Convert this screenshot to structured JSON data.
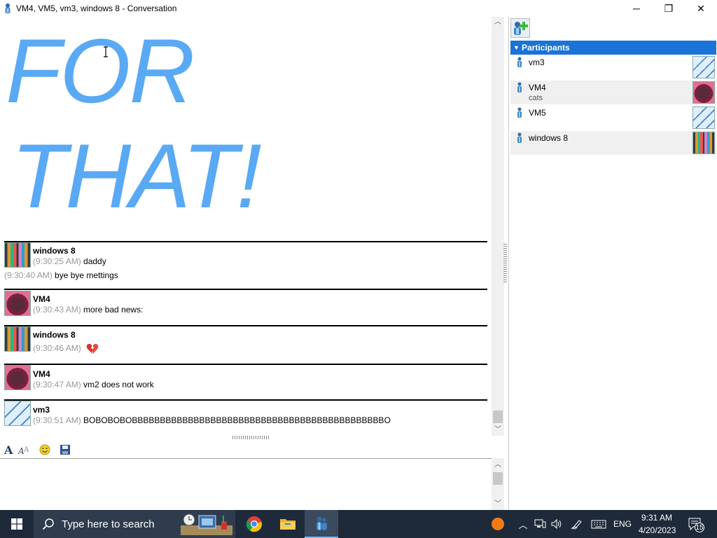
{
  "window": {
    "title": "VM4, VM5, vm3, windows 8 - Conversation",
    "minimize_glyph": "─",
    "maximize_glyph": "❐",
    "close_glyph": "✕"
  },
  "history": {
    "big_text_line1": "FOR",
    "big_text_line2": "THAT!",
    "messages": [
      {
        "sender": "windows 8",
        "avatar": "crayons-avatar",
        "lines": [
          {
            "ts": "(9:30:25 AM)",
            "text": " daddy"
          },
          {
            "ts": "(9:30:40 AM)",
            "text": " bye bye mettings"
          }
        ]
      },
      {
        "sender": "VM4",
        "avatar": "ball-avatar",
        "lines": [
          {
            "ts": "(9:30:43 AM)",
            "text": " more bad news:"
          }
        ]
      },
      {
        "sender": "windows 8",
        "avatar": "crayons-avatar",
        "lines": [
          {
            "ts": "(9:30:46 AM)",
            "text": ""
          }
        ],
        "emoticon": "broken-heart-icon"
      },
      {
        "sender": "VM4",
        "avatar": "ball-avatar",
        "lines": [
          {
            "ts": "(9:30:47 AM)",
            "text": " vm2 does not work"
          }
        ]
      },
      {
        "sender": "vm3",
        "avatar": "wave-avatar",
        "lines": [
          {
            "ts": "(9:30:51 AM)",
            "text": " BOBOBOBOBBBBBBBBBBBBBBBBBBBBBBBBBBBBBBBBBBBBBBBBBBBBBO"
          }
        ]
      }
    ]
  },
  "toolbar": {
    "icons": [
      "font-icon",
      "font-effects-icon",
      "smiley-icon",
      "save-icon"
    ]
  },
  "participants": {
    "header": "Participants",
    "items": [
      {
        "name": "vm3",
        "status": "",
        "avatar": "wave-avatar"
      },
      {
        "name": "VM4",
        "status": "cats",
        "avatar": "ball-avatar"
      },
      {
        "name": "VM5",
        "status": "",
        "avatar": "wave-avatar"
      },
      {
        "name": "windows 8",
        "status": "",
        "avatar": "crayons-avatar"
      }
    ]
  },
  "taskbar": {
    "search_placeholder": "Type here to search",
    "language": "ENG",
    "time": "9:31 AM",
    "date": "4/20/2023",
    "notification_count": "15",
    "colors": {
      "bar": "#1e2a3a",
      "accent": "#7ab8f5"
    }
  },
  "colors": {
    "big_text": "#5aa9f4",
    "participants_header": "#1a73d6",
    "timestamp": "#999999"
  }
}
